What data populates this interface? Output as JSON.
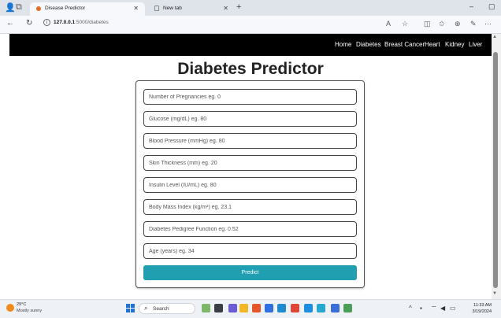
{
  "browser": {
    "tabs": [
      {
        "title": "Disease Predictor",
        "active": true
      },
      {
        "title": "New tab",
        "active": false
      }
    ],
    "url_host": "127.0.0.1",
    "url_path": ":5000/diabetes",
    "minimize_glyph": "–",
    "maximize_glyph": "▢"
  },
  "nav": {
    "links": [
      "Home",
      "Diabetes",
      "Breast Cancer",
      "Heart",
      "Kidney",
      "Liver"
    ]
  },
  "page": {
    "title": "Diabetes Predictor",
    "fields": [
      {
        "placeholder": "Number of Pregnancies eg. 0",
        "value": ""
      },
      {
        "placeholder": "Glucose (mg/dL) eg. 80",
        "value": ""
      },
      {
        "placeholder": "Blood Pressure (mmHg) eg. 80",
        "value": ""
      },
      {
        "placeholder": "Skin Thickness (mm) eg. 20",
        "value": ""
      },
      {
        "placeholder": "Insulin Level (IU/mL) eg. 80",
        "value": ""
      },
      {
        "placeholder": "Body Mass Index (kg/m²) eg. 23.1",
        "value": ""
      },
      {
        "placeholder": "Diabetes Pedigree Function eg. 0.52",
        "value": ""
      },
      {
        "placeholder": "Age (years) eg. 34",
        "value": ""
      }
    ],
    "predict_label": "Predict"
  },
  "taskbar": {
    "weather_temp": "29°C",
    "weather_desc": "Mostly sunny",
    "search_label": "Search",
    "time": "11:33 AM",
    "date": "3/19/2024"
  },
  "colors": {
    "nav_bg": "#000000",
    "button_bg": "#1f9fb0",
    "button_text": "#ffffff"
  }
}
